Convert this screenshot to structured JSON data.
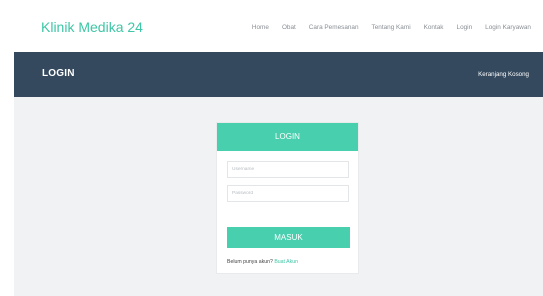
{
  "header": {
    "brand": "Klinik Medika 24",
    "nav": [
      "Home",
      "Obat",
      "Cara Pemesanan",
      "Tentang Kami",
      "Kontak",
      "Login",
      "Login Karyawan"
    ]
  },
  "titlebar": {
    "title": "LOGIN",
    "cart": "Keranjang Kosong"
  },
  "login_card": {
    "heading": "LOGIN",
    "username_placeholder": "Username",
    "password_placeholder": "Password",
    "submit_label": "MASUK",
    "signup_prompt": "Belum punya akun?",
    "signup_link": "Buat Akun"
  },
  "colors": {
    "accent": "#48cfae",
    "titlebar": "#34495e",
    "page_background": "#f0f2f4"
  }
}
